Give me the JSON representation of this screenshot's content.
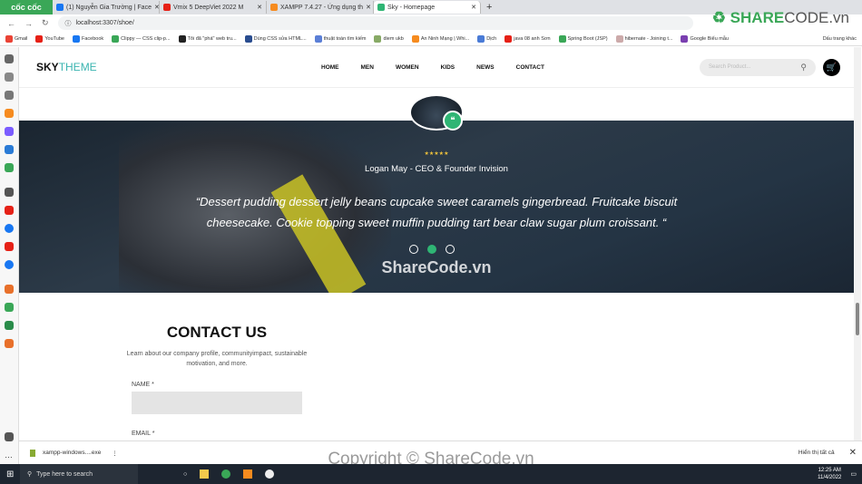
{
  "browser": {
    "brand": "cốc cốc",
    "tabs": [
      {
        "label": "(1) Nguyễn Gia Trường | Face",
        "color": "#1877f2"
      },
      {
        "label": "Vmix 5 DeepViet 2022 M",
        "color": "#e62117"
      },
      {
        "label": "XAMPP 7.4.27 - Ứng dụng th",
        "color": "#f68b1f"
      },
      {
        "label": "Sky - Homepage",
        "color": "#2fb574",
        "active": true
      }
    ],
    "url": "localhost:3307/shoe/",
    "bookmarks": [
      "Gmail",
      "YouTube",
      "Facebook",
      "Clippy — CSS clip-p...",
      "Tôi đã \"phá\" web tru...",
      "Dùng CSS sửa HTML...",
      "thuật toán tìm kiếm",
      "diem ukb",
      "An Ninh Mạng | Whi...",
      "Dịch",
      "java 08 anh Sơn",
      "Spring Boot (JSP)",
      "hibernate - Joining t...",
      "Google Biểu mẫu"
    ],
    "other_bookmarks": "Dấu trang khác",
    "watermark_logo": "SHARECODE.vn"
  },
  "site": {
    "logo_a": "SKY",
    "logo_b": "THEME",
    "nav": [
      "HOME",
      "MEN",
      "WOMEN",
      "KIDS",
      "NEWS",
      "CONTACT"
    ],
    "search_placeholder": "Search Product...",
    "testimonial": {
      "stars": "★★★★★",
      "rating": 5,
      "author": "Logan May - CEO & Founder Invision",
      "quote": "“Dessert pudding dessert jelly beans cupcake sweet caramels gingerbread. Fruitcake biscuit cheesecake. Cookie topping sweet muffin pudding tart bear claw sugar plum croissant. “",
      "active_slide": 2,
      "slides": 3
    },
    "hero_watermark": "ShareCode.vn",
    "contact": {
      "title": "CONTACT US",
      "subtitle": "Learn about our company profile, communityimpact, sustainable motivation, and more.",
      "name_label": "NAME *",
      "email_label": "EMAIL *"
    }
  },
  "downloads": {
    "file": "xampp-windows....exe",
    "show_all": "Hiển thị tất cả"
  },
  "copyright": "Copyright © ShareCode.vn",
  "taskbar": {
    "search": "Type here to search",
    "time": "12:25 AM",
    "date": "11/4/2022"
  }
}
